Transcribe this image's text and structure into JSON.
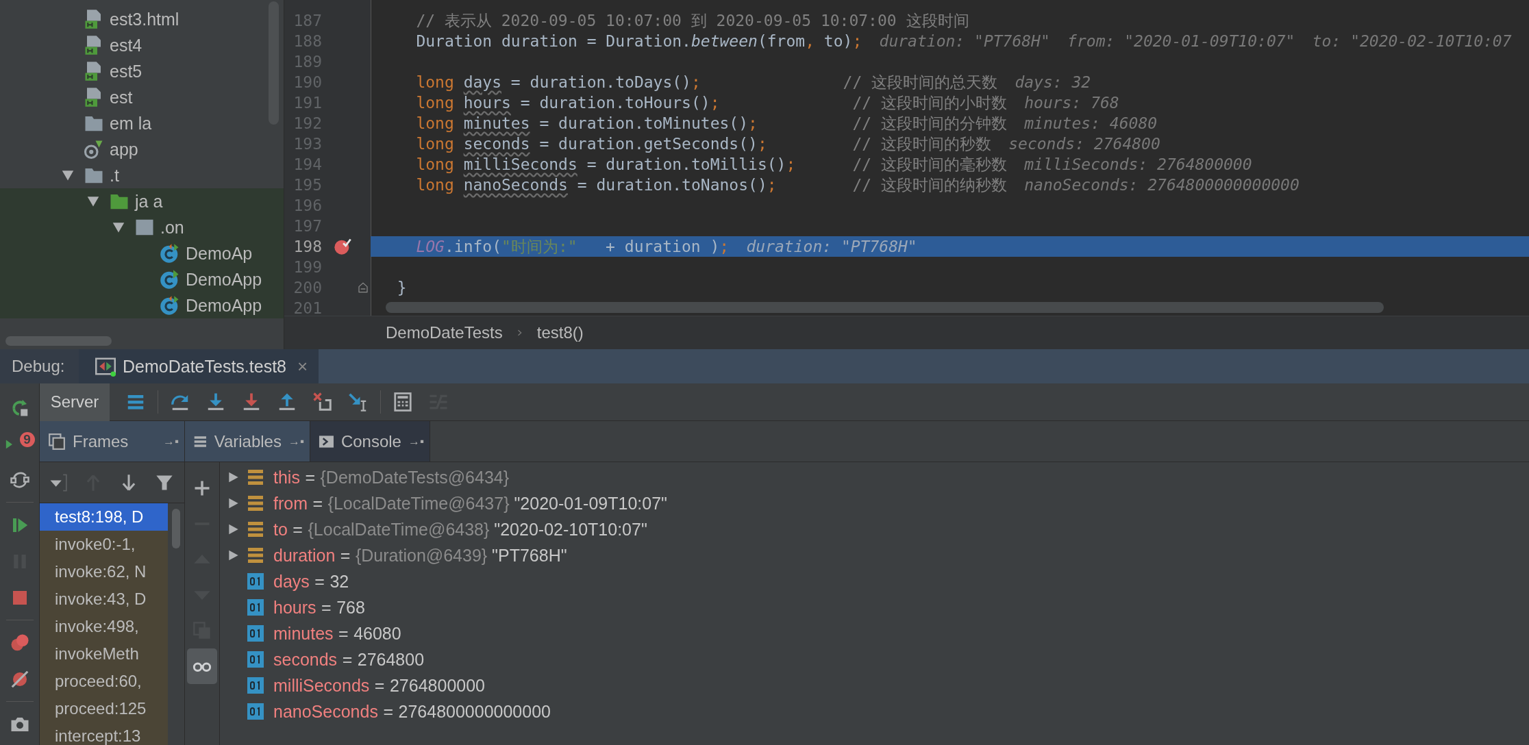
{
  "project_tree": {
    "items": [
      {
        "label": "est3.html",
        "kind": "html"
      },
      {
        "label": "est4",
        "kind": "html"
      },
      {
        "label": "est5",
        "kind": "html"
      },
      {
        "label": "est",
        "kind": "html"
      },
      {
        "label": "em la",
        "kind": "folder"
      },
      {
        "label": "app",
        "kind": "spring"
      },
      {
        "label": ".t",
        "kind": "folder",
        "expanded": true,
        "children": [
          {
            "label": "ja a",
            "kind": "test-root",
            "expanded": true,
            "children": [
              {
                "label": ".on",
                "kind": "package",
                "expanded": true,
                "children": [
                  {
                    "label": "DemoAp",
                    "kind": "test-class"
                  },
                  {
                    "label": "DemoApp",
                    "kind": "run-class"
                  },
                  {
                    "label": "DemoApp",
                    "kind": "test-class"
                  }
                ]
              }
            ]
          }
        ]
      }
    ]
  },
  "editor": {
    "lines": [
      {
        "number": "187",
        "breakpoint": false,
        "current": false,
        "fold": false,
        "tokens": [
          {
            "text": "    // 表示从 2020-09-05 10:07:00 到 2020-09-05 10:07:00 这段时间",
            "kind": "comment"
          }
        ]
      },
      {
        "number": "188",
        "breakpoint": false,
        "current": false,
        "fold": false,
        "tokens": [
          {
            "text": "    Duration duration = Duration.",
            "kind": "plain"
          },
          {
            "text": "between",
            "kind": "method"
          },
          {
            "text": "(from",
            "kind": "plain"
          },
          {
            "text": ",",
            "kind": "keyword"
          },
          {
            "text": " to)",
            "kind": "plain"
          },
          {
            "text": ";",
            "kind": "keyword"
          }
        ],
        "hints": [
          "duration: \"PT768H\"",
          "from: \"2020-01-09T10:07\"",
          "to: \"2020-02-10T10:07"
        ]
      },
      {
        "number": "189",
        "breakpoint": false,
        "current": false,
        "fold": false
      },
      {
        "number": "190",
        "breakpoint": false,
        "current": false,
        "fold": false,
        "tokens": [
          {
            "text": "    long ",
            "kind": "keyword"
          },
          {
            "text": "days",
            "kind": "var"
          },
          {
            "text": " = duration.toDays()",
            "kind": "plain"
          },
          {
            "text": ";               ",
            "kind": "keyword"
          },
          {
            "text": "// 这段时间的总天数",
            "kind": "comment"
          }
        ],
        "hints": [
          "days: 32"
        ]
      },
      {
        "number": "191",
        "breakpoint": false,
        "current": false,
        "fold": false,
        "tokens": [
          {
            "text": "    long ",
            "kind": "keyword"
          },
          {
            "text": "hours",
            "kind": "var"
          },
          {
            "text": " = duration.toHours()",
            "kind": "plain"
          },
          {
            "text": ";              ",
            "kind": "keyword"
          },
          {
            "text": "// 这段时间的小时数",
            "kind": "comment"
          }
        ],
        "hints": [
          "hours: 768"
        ]
      },
      {
        "number": "192",
        "breakpoint": false,
        "current": false,
        "fold": false,
        "tokens": [
          {
            "text": "    long ",
            "kind": "keyword"
          },
          {
            "text": "minutes",
            "kind": "var"
          },
          {
            "text": " = duration.toMinutes()",
            "kind": "plain"
          },
          {
            "text": ";          ",
            "kind": "keyword"
          },
          {
            "text": "// 这段时间的分钟数",
            "kind": "comment"
          }
        ],
        "hints": [
          "minutes: 46080"
        ]
      },
      {
        "number": "193",
        "breakpoint": false,
        "current": false,
        "fold": false,
        "tokens": [
          {
            "text": "    long ",
            "kind": "keyword"
          },
          {
            "text": "seconds",
            "kind": "var"
          },
          {
            "text": " = duration.getSeconds()",
            "kind": "plain"
          },
          {
            "text": ";         ",
            "kind": "keyword"
          },
          {
            "text": "// 这段时间的秒数",
            "kind": "comment"
          }
        ],
        "hints": [
          "seconds: 2764800"
        ]
      },
      {
        "number": "194",
        "breakpoint": false,
        "current": false,
        "fold": false,
        "tokens": [
          {
            "text": "    long ",
            "kind": "keyword"
          },
          {
            "text": "milliSeconds",
            "kind": "var"
          },
          {
            "text": " = duration.toMillis()",
            "kind": "plain"
          },
          {
            "text": ";      ",
            "kind": "keyword"
          },
          {
            "text": "// 这段时间的毫秒数",
            "kind": "comment"
          }
        ],
        "hints": [
          "milliSeconds: 2764800000"
        ]
      },
      {
        "number": "195",
        "breakpoint": false,
        "current": false,
        "fold": false,
        "tokens": [
          {
            "text": "    long ",
            "kind": "keyword"
          },
          {
            "text": "nanoSeconds",
            "kind": "var"
          },
          {
            "text": " = duration.toNanos()",
            "kind": "plain"
          },
          {
            "text": ";        ",
            "kind": "keyword"
          },
          {
            "text": "// 这段时间的纳秒数",
            "kind": "comment"
          }
        ],
        "hints": [
          "nanoSeconds: 2764800000000000"
        ]
      },
      {
        "number": "196",
        "breakpoint": false,
        "current": false,
        "fold": false
      },
      {
        "number": "197",
        "breakpoint": false,
        "current": false,
        "fold": false
      },
      {
        "number": "198",
        "breakpoint": true,
        "current": true,
        "fold": false,
        "tokens": [
          {
            "text": "    LOG",
            "kind": "field"
          },
          {
            "text": ".info(",
            "kind": "plain"
          },
          {
            "text": "\"时间为:\"",
            "kind": "string"
          },
          {
            "text": "   + duration )",
            "kind": "plain"
          },
          {
            "text": ";",
            "kind": "keyword"
          }
        ],
        "hints": [
          "duration: \"PT768H\""
        ]
      },
      {
        "number": "199",
        "breakpoint": false,
        "current": false,
        "fold": false
      },
      {
        "number": "200",
        "breakpoint": false,
        "current": false,
        "fold": true,
        "tokens": [
          {
            "text": "  }",
            "kind": "plain"
          }
        ]
      },
      {
        "number": "201",
        "breakpoint": false,
        "current": false,
        "fold": false
      }
    ],
    "breadcrumbs": [
      "DemoDateTests",
      "test8()"
    ]
  },
  "debug": {
    "label": "Debug:",
    "session_tab": {
      "title": "DemoDateTests.test8",
      "close": "×"
    },
    "side_toolbar": [
      {
        "kind": "rerun",
        "disabled": false
      },
      {
        "kind": "rerun-failed",
        "badge": "9",
        "disabled": false
      },
      {
        "kind": "restore-layout",
        "disabled": false
      },
      {
        "kind": "separator"
      },
      {
        "kind": "resume",
        "disabled": false
      },
      {
        "kind": "pause",
        "disabled": true
      },
      {
        "kind": "stop",
        "disabled": false
      },
      {
        "kind": "separator"
      },
      {
        "kind": "view-breakpoints",
        "disabled": false
      },
      {
        "kind": "mute-breakpoints",
        "disabled": false
      },
      {
        "kind": "separator"
      },
      {
        "kind": "camera",
        "disabled": false
      }
    ],
    "server_tab": {
      "label": "Server",
      "selected": true
    },
    "toolbar": [
      {
        "kind": "threads",
        "disabled": false
      },
      {
        "kind": "separator"
      },
      {
        "kind": "step-over",
        "disabled": false
      },
      {
        "kind": "step-into",
        "disabled": false
      },
      {
        "kind": "force-step-into",
        "disabled": false
      },
      {
        "kind": "step-out",
        "disabled": false
      },
      {
        "kind": "drop-frame",
        "disabled": false
      },
      {
        "kind": "run-to-cursor",
        "disabled": false
      },
      {
        "kind": "separator"
      },
      {
        "kind": "evaluate",
        "disabled": false
      },
      {
        "kind": "trace",
        "disabled": true
      }
    ],
    "panel_tabs": [
      {
        "label": "Frames",
        "kind": "frames",
        "pin": "→▪",
        "selected": true
      },
      {
        "label": "Variables",
        "kind": "variables",
        "pin": "→▪",
        "selected": true
      },
      {
        "label": "Console",
        "kind": "console",
        "pin": "→▪",
        "selected": false
      }
    ],
    "frames_toolbar": [
      {
        "kind": "dropdown",
        "disabled": false
      },
      {
        "kind": "up",
        "disabled": true
      },
      {
        "kind": "down",
        "disabled": false
      },
      {
        "kind": "filter",
        "disabled": false
      }
    ],
    "frames": [
      {
        "text": "test8:198, D",
        "selected": true
      },
      {
        "text": "invoke0:-1,",
        "selected": false
      },
      {
        "text": "invoke:62, N",
        "selected": false
      },
      {
        "text": "invoke:43, D",
        "selected": false
      },
      {
        "text": "invoke:498,",
        "selected": false
      },
      {
        "text": "invokeMeth",
        "selected": false
      },
      {
        "text": "proceed:60,",
        "selected": false
      },
      {
        "text": "proceed:125",
        "selected": false
      },
      {
        "text": "intercept:13",
        "selected": false
      }
    ],
    "variables_toolbar": [
      {
        "kind": "add",
        "disabled": false
      },
      {
        "kind": "remove",
        "disabled": true
      },
      {
        "kind": "move-up",
        "disabled": true
      },
      {
        "kind": "move-down",
        "disabled": true
      },
      {
        "kind": "duplicate",
        "disabled": true
      },
      {
        "kind": "watches",
        "disabled": false,
        "on": true
      }
    ],
    "variables": [
      {
        "kind": "object",
        "name": "this",
        "equals": "=",
        "type": "{DemoDateTests@6434}"
      },
      {
        "kind": "object",
        "name": "from",
        "equals": "=",
        "type": "{LocalDateTime@6437}",
        "value": "\"2020-01-09T10:07\""
      },
      {
        "kind": "object",
        "name": "to",
        "equals": "=",
        "type": "{LocalDateTime@6438}",
        "value": "\"2020-02-10T10:07\""
      },
      {
        "kind": "object",
        "name": "duration",
        "equals": "=",
        "type": "{Duration@6439}",
        "value": "\"PT768H\""
      },
      {
        "kind": "primitive",
        "name": "days",
        "equals": "=",
        "value": "32"
      },
      {
        "kind": "primitive",
        "name": "hours",
        "equals": "=",
        "value": "768"
      },
      {
        "kind": "primitive",
        "name": "minutes",
        "equals": "=",
        "value": "46080"
      },
      {
        "kind": "primitive",
        "name": "seconds",
        "equals": "=",
        "value": "2764800"
      },
      {
        "kind": "primitive",
        "name": "milliSeconds",
        "equals": "=",
        "value": "2764800000"
      },
      {
        "kind": "primitive",
        "name": "nanoSeconds",
        "equals": "=",
        "value": "2764800000000000"
      }
    ]
  }
}
